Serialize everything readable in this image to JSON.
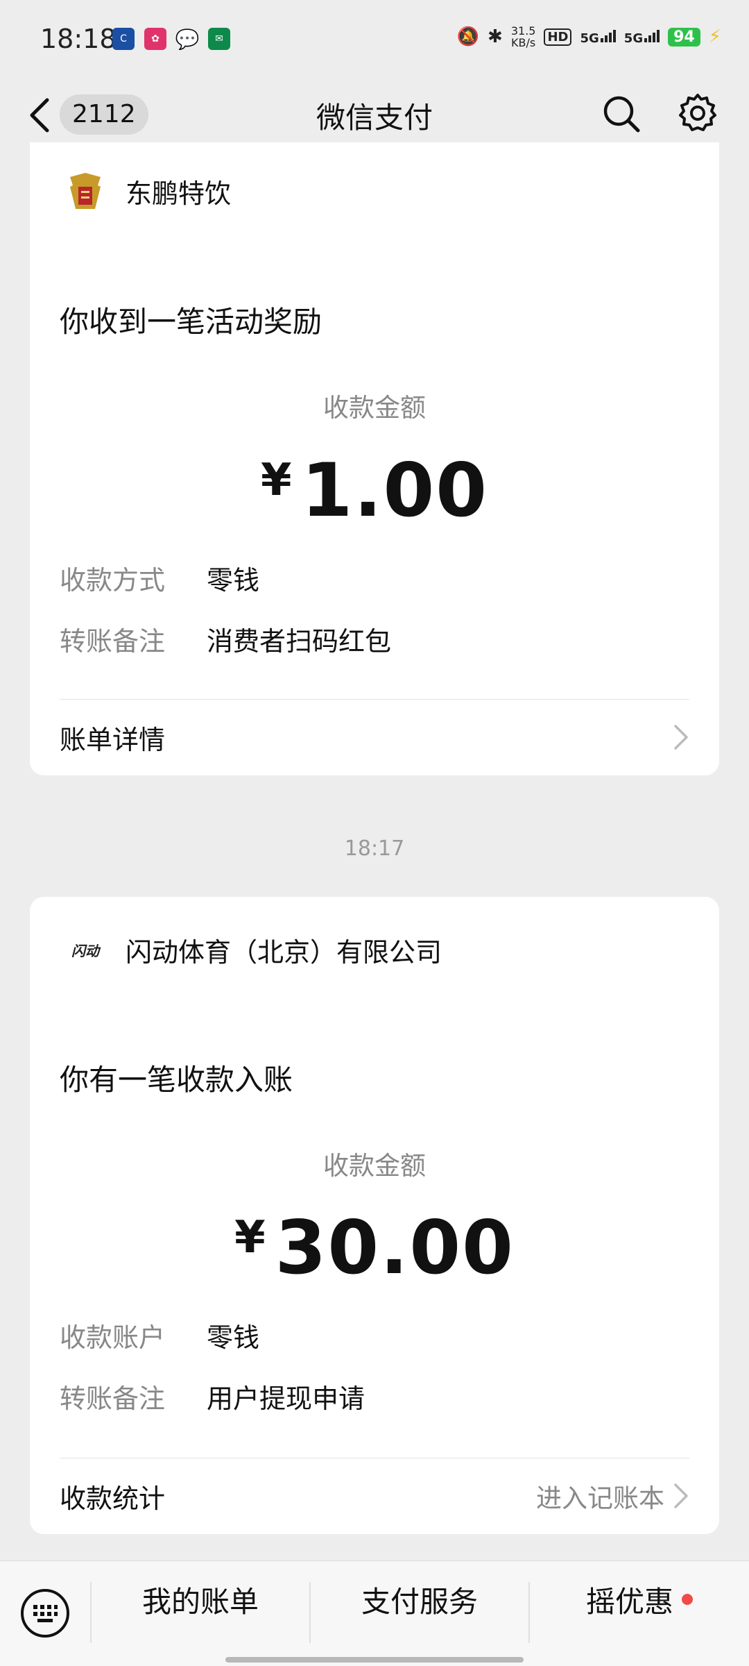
{
  "status_bar": {
    "time": "18:18",
    "net_speed_top": "31.5",
    "net_speed_bottom": "KB/s",
    "hd_label": "HD",
    "signal_1": "5G",
    "signal_2": "5G",
    "battery": "94"
  },
  "nav": {
    "badge": "2112",
    "title": "微信支付"
  },
  "messages": [
    {
      "merchant": "东鹏特饮",
      "headline": "你收到一笔活动奖励",
      "amount_label": "收款金额",
      "currency": "¥",
      "amount": "1.00",
      "rows": [
        {
          "key": "收款方式",
          "value": "零钱"
        },
        {
          "key": "转账备注",
          "value": "消费者扫码红包"
        }
      ],
      "footer": "账单详情",
      "footer_right": ""
    },
    {
      "merchant": "闪动体育（北京）有限公司",
      "logo_text": "闪动",
      "headline": "你有一笔收款入账",
      "amount_label": "收款金额",
      "currency": "¥",
      "amount": "30.00",
      "rows": [
        {
          "key": "收款账户",
          "value": "零钱"
        },
        {
          "key": "转账备注",
          "value": "用户提现申请"
        }
      ],
      "footer": "收款统计",
      "footer_right": "进入记账本"
    }
  ],
  "timestamp": "18:17",
  "bottom_menu": {
    "items": [
      "我的账单",
      "支付服务",
      "摇优惠"
    ]
  },
  "colors": {
    "background": "#ededed",
    "card": "#ffffff",
    "battery": "#2ec14a",
    "dot": "#f24a4a"
  }
}
